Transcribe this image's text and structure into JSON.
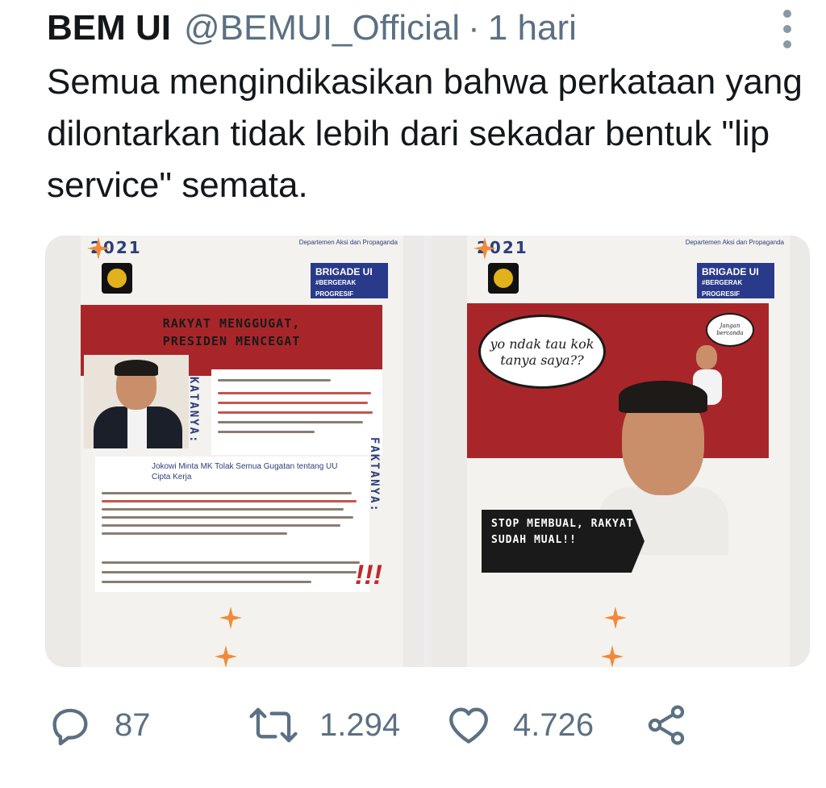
{
  "tweet": {
    "author": "BEM UI",
    "handle": "@BEMUI_Official",
    "separator": "·",
    "time": "1 hari",
    "text": "Semua mengindikasikan bahwa perkataan yang dilontarkan tidak lebih dari sekadar bentuk \"lip service\" semata."
  },
  "media": {
    "left": {
      "year": "2021",
      "dept": "Departemen Aksi dan Propaganda",
      "brigade": "BRIGADE UI",
      "brigade_sub": "#BERGERAK PROGRESIF",
      "headline_1": "RAKYAT MENGGUGAT,",
      "headline_2": "PRESIDEN MENCEGAT",
      "label_left": "KATANYA:",
      "label_right": "FAKTANYA:",
      "news_title": "Jokowi Minta MK Tolak Semua Gugatan tentang UU Cipta Kerja"
    },
    "right": {
      "year": "2021",
      "dept": "Departemen Aksi dan Propaganda",
      "brigade": "BRIGADE UI",
      "brigade_sub": "#BERGERAK PROGRESIF",
      "bubble_main": "yo ndak tau kok tanya saya??",
      "bubble_small": "Jangan bercanda",
      "stop_text": "STOP MEMBUAL, RAKYAT SUDAH MUAL!!"
    }
  },
  "actions": {
    "reply_count": "87",
    "retweet_count": "1.294",
    "like_count": "4.726"
  },
  "icons": {
    "reply": "reply-icon",
    "retweet": "retweet-icon",
    "like": "heart-icon",
    "share": "share-icon",
    "more": "more-vertical-icon"
  },
  "colors": {
    "secondary_text": "#5b7083",
    "poster_red": "#a8262a",
    "poster_blue": "#2a3a8a"
  }
}
